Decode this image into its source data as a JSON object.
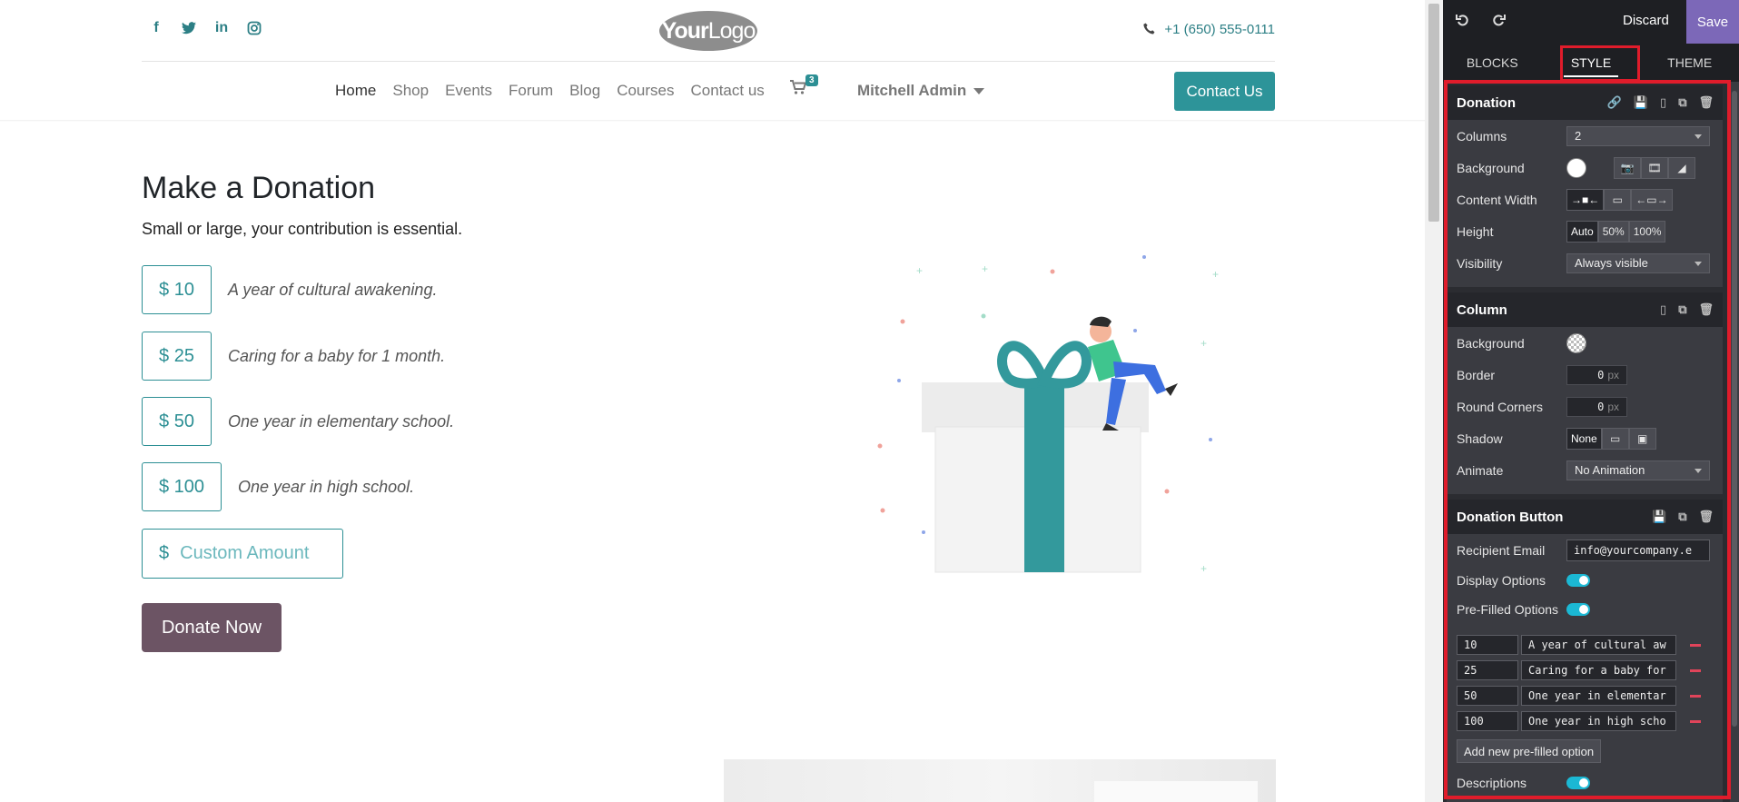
{
  "site": {
    "social": {
      "facebook": "f",
      "twitter": "t",
      "linkedin": "in",
      "instagram": "◎"
    },
    "logo": {
      "part1": "Your",
      "part2": "Logo"
    },
    "phone": "+1 (650) 555-0111",
    "nav": [
      "Home",
      "Shop",
      "Events",
      "Forum",
      "Blog",
      "Courses",
      "Contact us"
    ],
    "cart_count": "3",
    "user": "Mitchell Admin",
    "contact_button": "Contact Us",
    "donation": {
      "title": "Make a Donation",
      "subtitle": "Small or large, your contribution is essential.",
      "options": [
        {
          "amount": "$ 10",
          "desc": "A year of cultural awakening."
        },
        {
          "amount": "$ 25",
          "desc": "Caring for a baby for 1 month."
        },
        {
          "amount": "$ 50",
          "desc": "One year in elementary school."
        },
        {
          "amount": "$ 100",
          "desc": "One year in high school."
        }
      ],
      "custom_dollar": "$",
      "custom_placeholder": "Custom Amount",
      "donate_button": "Donate Now"
    },
    "colors": {
      "primary": "#2d9499",
      "donate": "#6c5464"
    }
  },
  "editor": {
    "discard": "Discard",
    "save": "Save",
    "tabs": [
      "BLOCKS",
      "STYLE",
      "THEME"
    ],
    "active_tab": "STYLE",
    "donation": {
      "title": "Donation",
      "columns_label": "Columns",
      "columns_value": "2",
      "background_label": "Background",
      "content_width_label": "Content Width",
      "height_label": "Height",
      "height_options": [
        "Auto",
        "50%",
        "100%"
      ],
      "visibility_label": "Visibility",
      "visibility_value": "Always visible"
    },
    "column": {
      "title": "Column",
      "background_label": "Background",
      "border_label": "Border",
      "border_value": "0",
      "border_unit": "px",
      "round_label": "Round Corners",
      "round_value": "0",
      "round_unit": "px",
      "shadow_label": "Shadow",
      "shadow_none": "None",
      "animate_label": "Animate",
      "animate_value": "No Animation"
    },
    "donation_button": {
      "title": "Donation Button",
      "recipient_label": "Recipient Email",
      "recipient_value": "info@yourcompany.e",
      "display_label": "Display Options",
      "prefilled_label": "Pre-Filled Options",
      "options": [
        {
          "value": "10",
          "desc": "A year of cultural aw"
        },
        {
          "value": "25",
          "desc": "Caring for a baby for"
        },
        {
          "value": "50",
          "desc": "One year in elementar"
        },
        {
          "value": "100",
          "desc": "One year in high scho"
        }
      ],
      "add_option": "Add new pre-filled option",
      "descriptions_label": "Descriptions"
    },
    "colors": {
      "save": "#7c68b8",
      "highlight": "#e01c2b",
      "toggle": "#1bb8d4"
    }
  }
}
